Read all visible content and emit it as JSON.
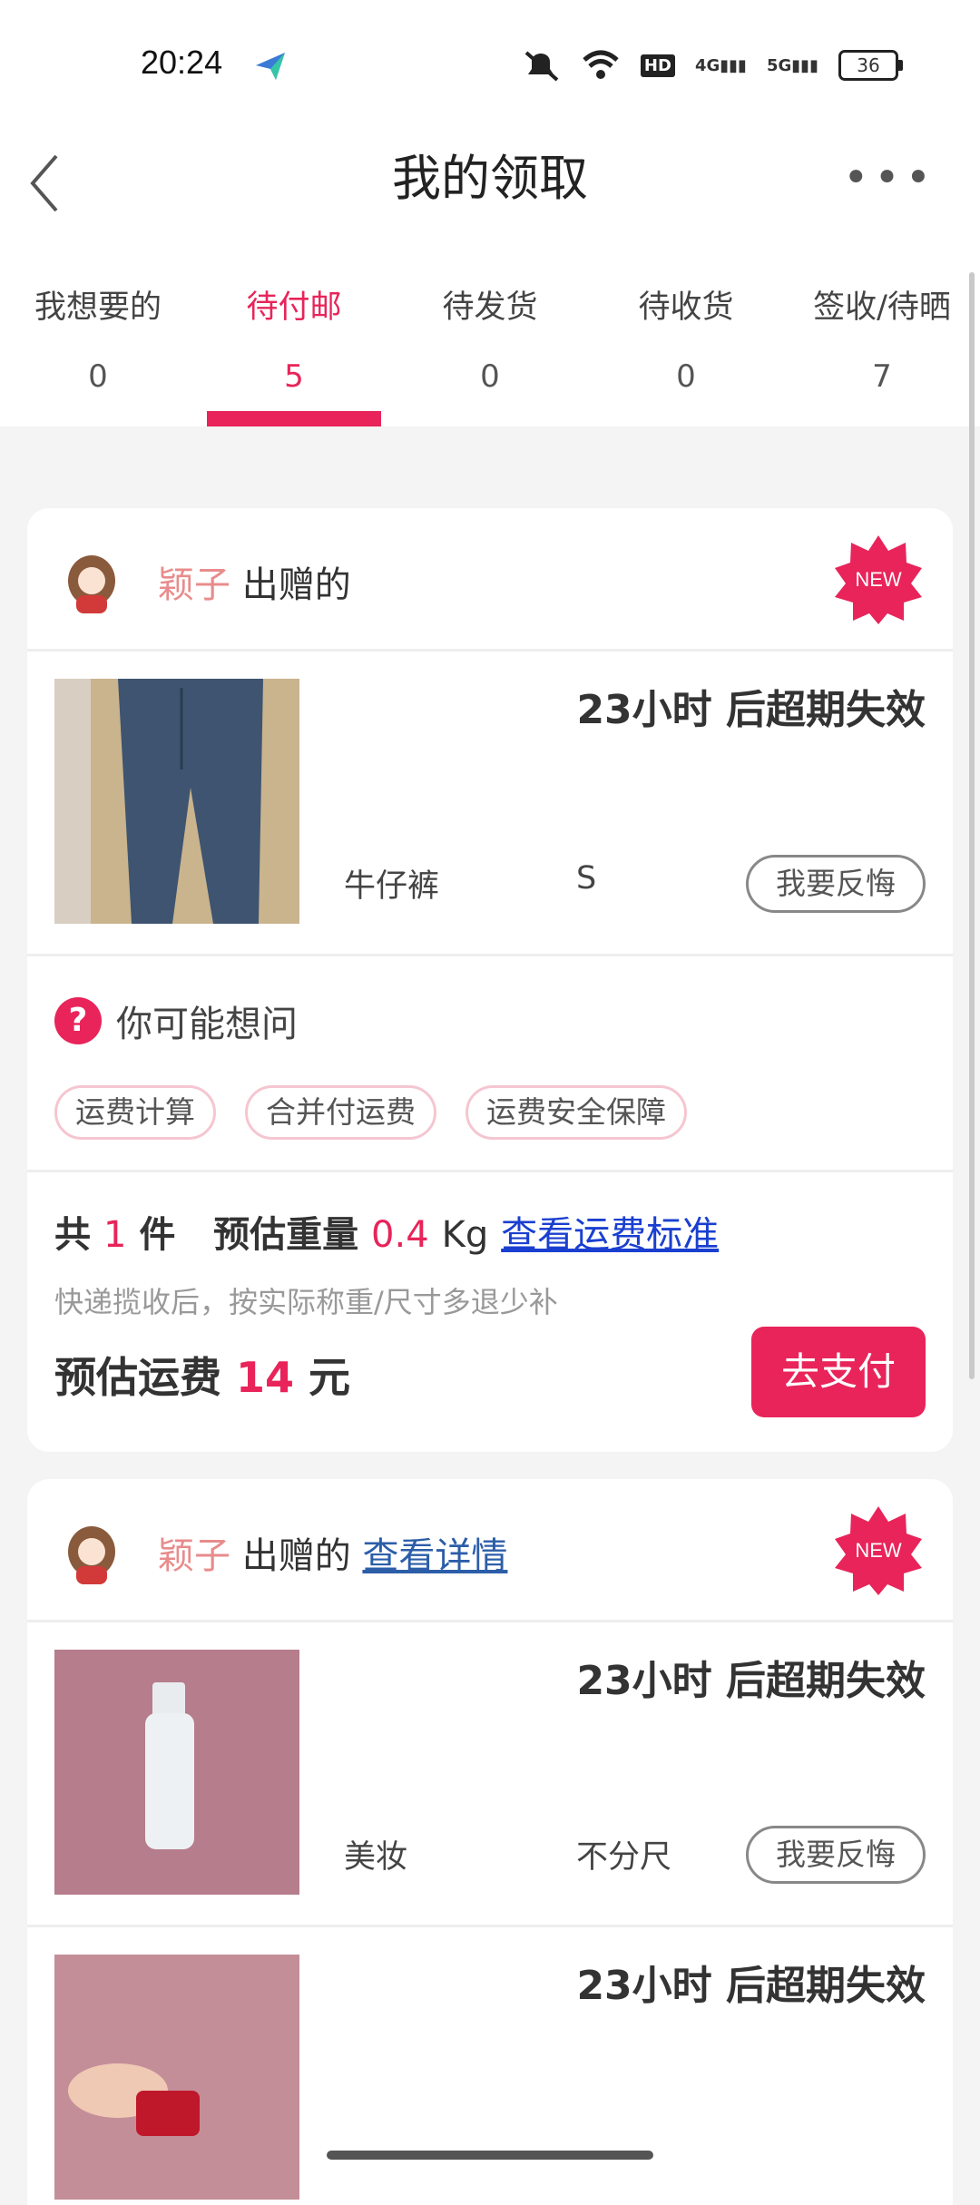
{
  "status": {
    "time": "20:24",
    "battery": "36",
    "hd": "HD",
    "sig1": "4G",
    "sig2": "5G"
  },
  "header": {
    "title": "我的领取",
    "more": "•••"
  },
  "tabs": [
    {
      "label": "我想要的",
      "count": "0"
    },
    {
      "label": "待付邮",
      "count": "5"
    },
    {
      "label": "待发货",
      "count": "0"
    },
    {
      "label": "待收货",
      "count": "0"
    },
    {
      "label": "签收/待晒",
      "count": "7"
    }
  ],
  "cards": [
    {
      "giver": "颖子",
      "gave": "出赠的",
      "detail": "",
      "new": "NEW",
      "items": [
        {
          "expire": "23小时 后超期失效",
          "category": "牛仔裤",
          "size": "S",
          "regret": "我要反悔"
        }
      ],
      "faq": {
        "q": "你可能想问",
        "chips": [
          "运费计算",
          "合并付运费",
          "运费安全保障"
        ]
      },
      "summary": {
        "total_pre": "共",
        "count": "1",
        "unit": "件",
        "weight_lbl": "预估重量",
        "weight": "0.4",
        "weight_unit": "Kg",
        "std_link": "查看运费标准",
        "note": "快递揽收后，按实际称重/尺寸多退少补",
        "fee_lbl": "预估运费",
        "fee": "14",
        "fee_unit": "元",
        "pay": "去支付"
      }
    },
    {
      "giver": "颖子",
      "gave": "出赠的",
      "detail": "查看详情",
      "new": "NEW",
      "items": [
        {
          "expire": "23小时 后超期失效",
          "category": "美妆",
          "size": "不分尺",
          "regret": "我要反悔"
        },
        {
          "expire": "23小时 后超期失效"
        }
      ]
    }
  ]
}
